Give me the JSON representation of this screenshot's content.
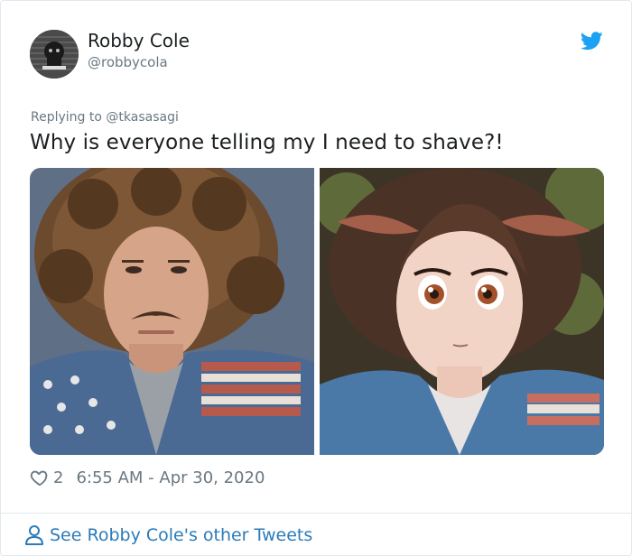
{
  "tweet": {
    "author": {
      "name": "Robby Cole",
      "handle": "@robbycola"
    },
    "replying_to": {
      "prefix": "Replying to",
      "mention": "@tkasasagi"
    },
    "text": "Why is everyone telling my I need to shave?!",
    "likes": "2",
    "timestamp": "6:55 AM - Apr 30, 2020",
    "see_more": "See Robby Cole's other Tweets"
  },
  "colors": {
    "twitter_blue": "#1da1f2",
    "link_blue": "#2b7bb9",
    "meta_gray": "#697882",
    "text_dark": "#1c2022"
  },
  "icons": {
    "brand": "twitter-bird-icon",
    "like": "heart-icon",
    "profile": "person-icon"
  }
}
